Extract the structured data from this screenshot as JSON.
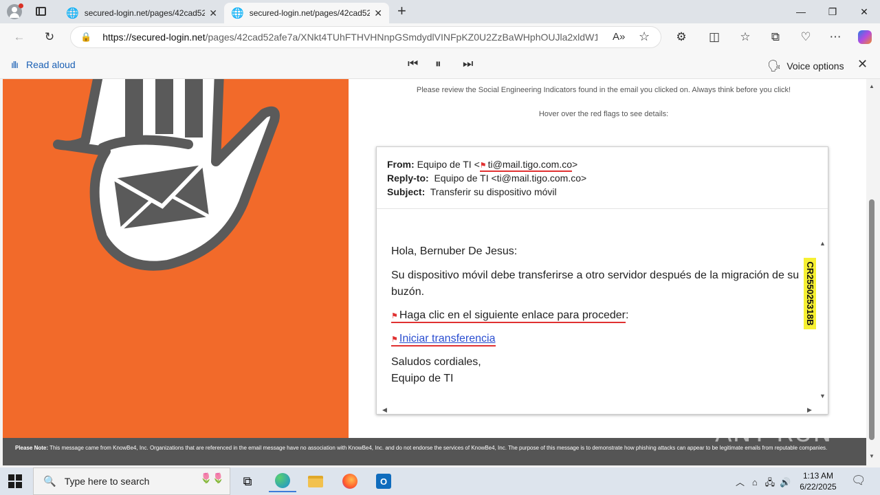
{
  "browser": {
    "tabs": [
      {
        "label": "secured-login.net/pages/42cad52",
        "active": false
      },
      {
        "label": "secured-login.net/pages/42cad52",
        "active": true
      }
    ],
    "new_tab_glyph": "+",
    "url_domain": "https://secured-login.net",
    "url_path": "/pages/42cad52afe7a/XNkt4TUhFTHVHNnpGSmdydlVINFpKZ0U2ZzBaWHphOUJla2xldW1...",
    "read_aloud": {
      "label": "Read aloud",
      "voice_options": "Voice options"
    }
  },
  "page": {
    "review_text": "Please review the Social Engineering Indicators found in the email you clicked on. Always think before you click!",
    "hover_text": "Hover over the red flags to see details:",
    "email": {
      "from_label": "From:",
      "from_value": "Equipo de TI <",
      "from_email": "ti@mail.tigo.com.co",
      "from_end": ">",
      "reply_label": "Reply-to:",
      "reply_value": "Equipo de TI <ti@mail.tigo.com.co>",
      "subject_label": "Subject:",
      "subject_value": "Transferir su dispositivo móvil",
      "greeting": "Hola, Bernuber De Jesus:",
      "body_line1": "Su dispositivo móvil debe transferirse a otro servidor después de la migración de su",
      "body_line2": "buzón.",
      "click_text": "Haga clic en el siguiente enlace para proceder",
      "click_colon": ":",
      "link_text": "Iniciar transferencia",
      "closing1": "Saludos cordiales,",
      "closing2": "Equipo de TI",
      "code_tag": "CR255025318B"
    },
    "footer": {
      "please_note": "Please Note:",
      "text": "This message came from KnowBe4, Inc. Organizations that are referenced in the email message have no association with KnowBe4, Inc. and do not endorse the services of KnowBe4, Inc. The purpose of this message is to demonstrate how phishing attacks can appear to be legitimate emails from reputable companies."
    },
    "watermark": "ANY RUN"
  },
  "taskbar": {
    "search_placeholder": "Type here to search",
    "time": "1:13 AM",
    "date": "6/22/2025"
  },
  "colors": {
    "orange": "#f26a2a",
    "flag_red": "#e03030",
    "link_blue": "#2a4dd0",
    "tag_yellow": "#f6f032"
  }
}
